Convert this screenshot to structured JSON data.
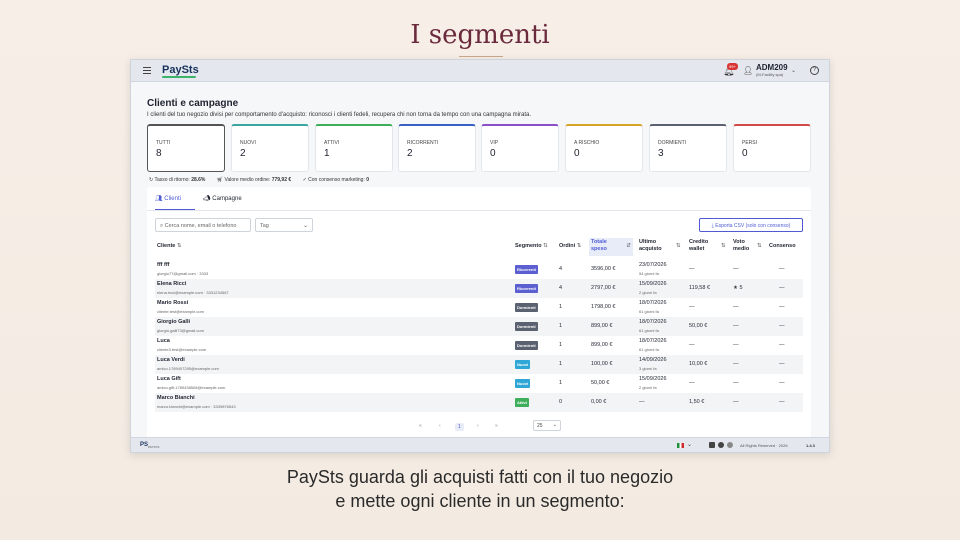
{
  "slide": {
    "title": "I segmenti",
    "caption_line1": "PaySts guarda gli acquisti fatti con il tuo negozio",
    "caption_line2": "e mette ogni cliente in un segmento:"
  },
  "topbar": {
    "logo": "PaySts",
    "notification_badge": "99+",
    "user_name": "ADM209",
    "user_company": "(M-Facility spa)",
    "help": "?"
  },
  "page": {
    "title": "Clienti e campagne",
    "subtitle": "I clienti del tuo negozio divisi per comportamento d'acquisto: riconosci i clienti fedeli, recupera chi non torna da tempo con una campagna mirata."
  },
  "segments": [
    {
      "label": "TUTTI",
      "value": "8",
      "color": "#555555"
    },
    {
      "label": "NUOVI",
      "value": "2",
      "color": "#3aa6a0"
    },
    {
      "label": "ATTIVI",
      "value": "1",
      "color": "#3fae5b"
    },
    {
      "label": "RICORRENTI",
      "value": "2",
      "color": "#3a5fc2"
    },
    {
      "label": "VIP",
      "value": "0",
      "color": "#8a4fc9"
    },
    {
      "label": "A RISCHIO",
      "value": "0",
      "color": "#d8a427"
    },
    {
      "label": "DORMIENTI",
      "value": "3",
      "color": "#5a6170"
    },
    {
      "label": "PERSI",
      "value": "0",
      "color": "#d44a4a"
    }
  ],
  "stats": {
    "return_label": "Tasso di ritorno:",
    "return_value": "28.6%",
    "avg_label": "Valore medio ordine:",
    "avg_value": "779,92 €",
    "consent_label": "Con consenso marketing:",
    "consent_value": "0"
  },
  "tabs": {
    "clients": "Clienti",
    "campaigns": "Campagne"
  },
  "toolbar": {
    "search_placeholder": "Cerca nome, email o telefono",
    "tag_placeholder": "Tag",
    "export_label": "Esporta CSV (solo con consenso)"
  },
  "table": {
    "headers": {
      "cliente": "Cliente",
      "segmento": "Segmento",
      "ordini": "Ordini",
      "totale": "Totale",
      "speso": "speso",
      "ultimo": "Ultimo",
      "acquisto": "acquisto",
      "credito": "Credito",
      "wallet": "wallet",
      "voto": "Voto",
      "medio": "medio",
      "consenso": "Consenso"
    },
    "rows": [
      {
        "name": "fff fff",
        "contact": "giorgio77@gmail.com · 3333",
        "segment": "Ricorrenti",
        "seg_color": "#5b5fd0",
        "orders": "4",
        "total": "3596,00 €",
        "last": "23/07/2026",
        "last_ago": "54 giorni fa",
        "wallet": "—",
        "rating": "—",
        "consent": "—"
      },
      {
        "name": "Elena Ricci",
        "contact": "elena.ricci@example.com · 3331234567",
        "segment": "Ricorrenti",
        "seg_color": "#5b5fd0",
        "orders": "4",
        "total": "2797,00 €",
        "last": "15/09/2026",
        "last_ago": "2 giorni fa",
        "wallet": "119,58 €",
        "rating": "5",
        "consent": "—"
      },
      {
        "name": "Mario Rossi",
        "contact": "cliente.test@example.com",
        "segment": "Dormienti",
        "seg_color": "#5a6170",
        "orders": "1",
        "total": "1798,00 €",
        "last": "18/07/2026",
        "last_ago": "61 giorni fa",
        "wallet": "—",
        "rating": "—",
        "consent": "—"
      },
      {
        "name": "Giorgio Galli",
        "contact": "giorgio.galli73@gmail.com",
        "segment": "Dormienti",
        "seg_color": "#5a6170",
        "orders": "1",
        "total": "899,00 €",
        "last": "18/07/2026",
        "last_ago": "61 giorni fa",
        "wallet": "50,00 €",
        "rating": "—",
        "consent": "—"
      },
      {
        "name": "Luca",
        "contact": "cliente3.test@example.com",
        "segment": "Dormienti",
        "seg_color": "#5a6170",
        "orders": "1",
        "total": "899,00 €",
        "last": "18/07/2026",
        "last_ago": "61 giorni fa",
        "wallet": "—",
        "rating": "—",
        "consent": "—"
      },
      {
        "name": "Luca Verdi",
        "contact": "amico.1789407295@example.com",
        "segment": "Nuovi",
        "seg_color": "#2ea7d6",
        "orders": "1",
        "total": "100,00 €",
        "last": "14/09/2026",
        "last_ago": "3 giorni fa",
        "wallet": "10,00 €",
        "rating": "—",
        "consent": "—"
      },
      {
        "name": "Luca Gift",
        "contact": "amico.gift.1789438508@example.com",
        "segment": "Nuovi",
        "seg_color": "#2ea7d6",
        "orders": "1",
        "total": "50,00 €",
        "last": "15/09/2026",
        "last_ago": "2 giorni fa",
        "wallet": "—",
        "rating": "—",
        "consent": "—"
      },
      {
        "name": "Marco Bianchi",
        "contact": "marco.bianchi@example.com · 3339876543",
        "segment": "Attivi",
        "seg_color": "#3fae5b",
        "orders": "0",
        "total": "0,00 €",
        "last": "—",
        "last_ago": "",
        "wallet": "1,50 €",
        "rating": "—",
        "consent": "—"
      }
    ]
  },
  "pagination": {
    "first": "«",
    "prev": "‹",
    "current": "1",
    "next": "›",
    "last": "»",
    "per_page": "25"
  },
  "footer": {
    "logo": "PS",
    "logo_sub": "PAYSTS",
    "rights": "All Rights Reserved · 2026",
    "version": "1.4.3"
  },
  "icons": {
    "menu": "hamburger-icon",
    "bell": "bell-icon",
    "user": "user-icon",
    "help": "help-icon",
    "search": "search-icon",
    "export": "download-icon",
    "star": "star-icon"
  }
}
